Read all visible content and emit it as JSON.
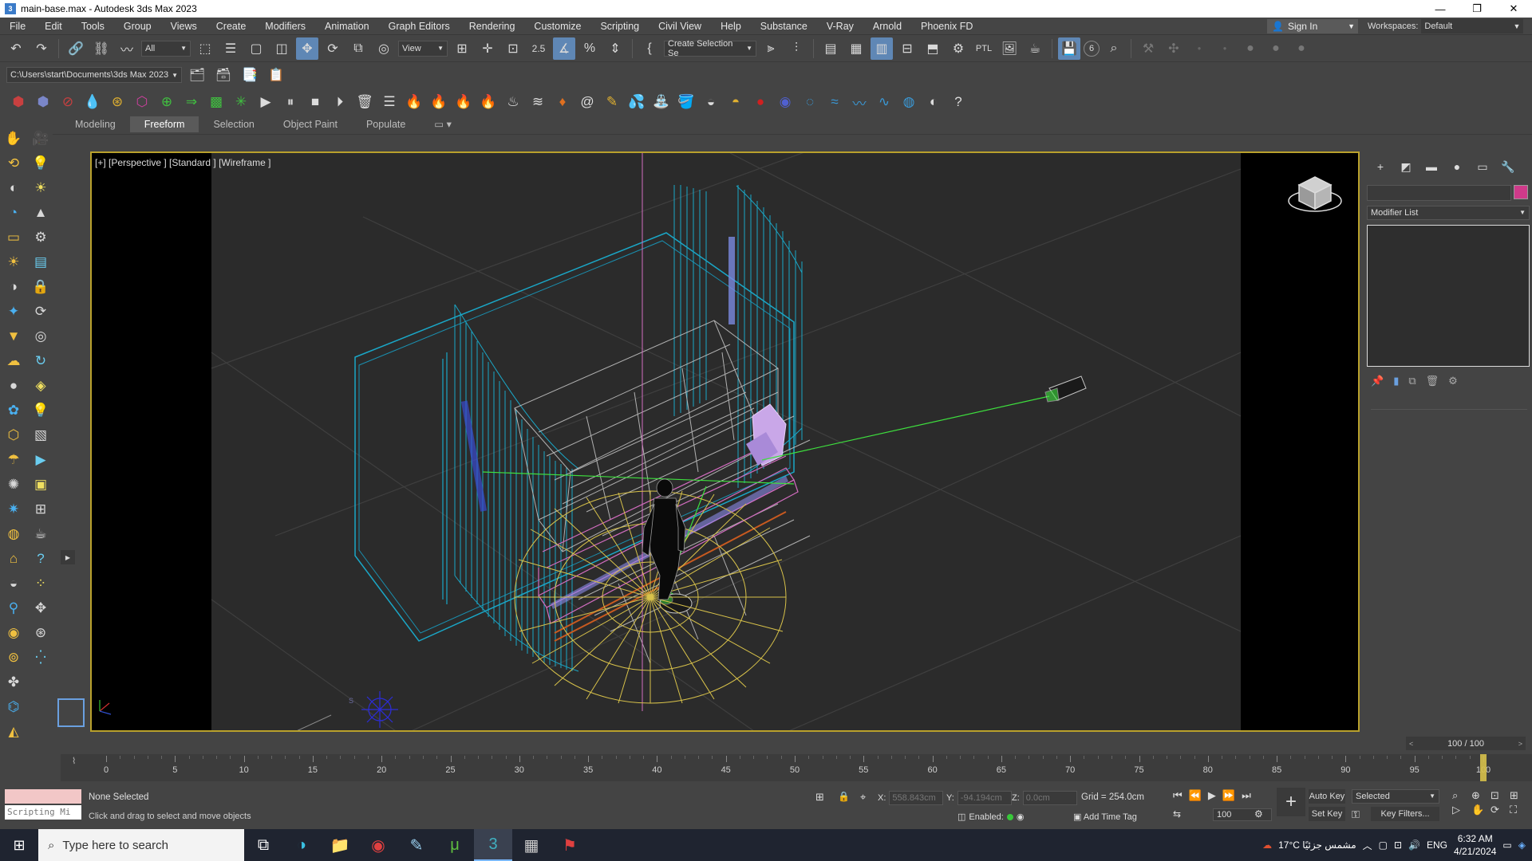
{
  "window": {
    "title": "main-base.max - Autodesk 3ds Max 2023",
    "app_icon": "3",
    "controls": [
      "minimize-icon",
      "restore-icon",
      "close-icon"
    ],
    "control_glyphs": [
      "—",
      "❐",
      "✕"
    ]
  },
  "menubar": {
    "items": [
      "File",
      "Edit",
      "Tools",
      "Group",
      "Views",
      "Create",
      "Modifiers",
      "Animation",
      "Graph Editors",
      "Rendering",
      "Customize",
      "Scripting",
      "Civil View",
      "Help",
      "Substance",
      "V-Ray",
      "Arnold",
      "Phoenix FD"
    ],
    "sign_in": "Sign In",
    "workspaces_label": "Workspaces:",
    "workspaces_value": "Default"
  },
  "toolbar": {
    "selection_filter": "All",
    "ref_coord": "View",
    "named_selection": "Create Selection Se",
    "ptl_label": "PTL",
    "snap_badge": "6",
    "snap_angle": "2.5"
  },
  "project": {
    "path": "C:\\Users\\start\\Documents\\3ds Max 2023"
  },
  "ribbon": {
    "tabs": [
      "Modeling",
      "Freeform",
      "Selection",
      "Object Paint",
      "Populate"
    ],
    "active_tab": "Freeform"
  },
  "viewport": {
    "label": "[+] [Perspective ] [Standard ] [Wireframe ]",
    "sun_label": "S",
    "colors": {
      "border": "#b9a12c",
      "bg": "#000000",
      "grid": "#3a3a3a",
      "cyan": "#1aa7c7",
      "yellow": "#d8c24a",
      "green": "#3ee03e",
      "pink": "#d36dc0",
      "white": "#c8c8c8",
      "blue": "#2c2cd8"
    }
  },
  "command_panel": {
    "modifier_list": "Modifier List",
    "object_color": "#cf3a8a"
  },
  "timeline": {
    "frame_counter": "100 / 100",
    "ticks": [
      0,
      5,
      10,
      15,
      20,
      25,
      30,
      35,
      40,
      45,
      50,
      55,
      60,
      65,
      70,
      75,
      80,
      85,
      90,
      95,
      100
    ],
    "current_frame": 100,
    "max_frame": 100
  },
  "status": {
    "selection": "None Selected",
    "prompt": "Click and drag to select and move objects",
    "maxscript": "Scripting Mi",
    "x_label": "X:",
    "x_value": "558.843cm",
    "y_label": "Y:",
    "y_value": "-94.194cm",
    "z_label": "Z:",
    "z_value": "0.0cm",
    "grid": "Grid = 254.0cm",
    "enabled_label": "Enabled:",
    "add_time_tag": "Add Time Tag",
    "auto_key": "Auto Key",
    "set_key": "Set Key",
    "key_mode": "Selected",
    "key_filters": "Key Filters...",
    "frame_value": "100"
  },
  "taskbar": {
    "search_placeholder": "Type here to search",
    "weather": "17°C  مشمس جزئيًا",
    "language": "ENG",
    "time": "6:32 AM",
    "date": "4/21/2024"
  }
}
